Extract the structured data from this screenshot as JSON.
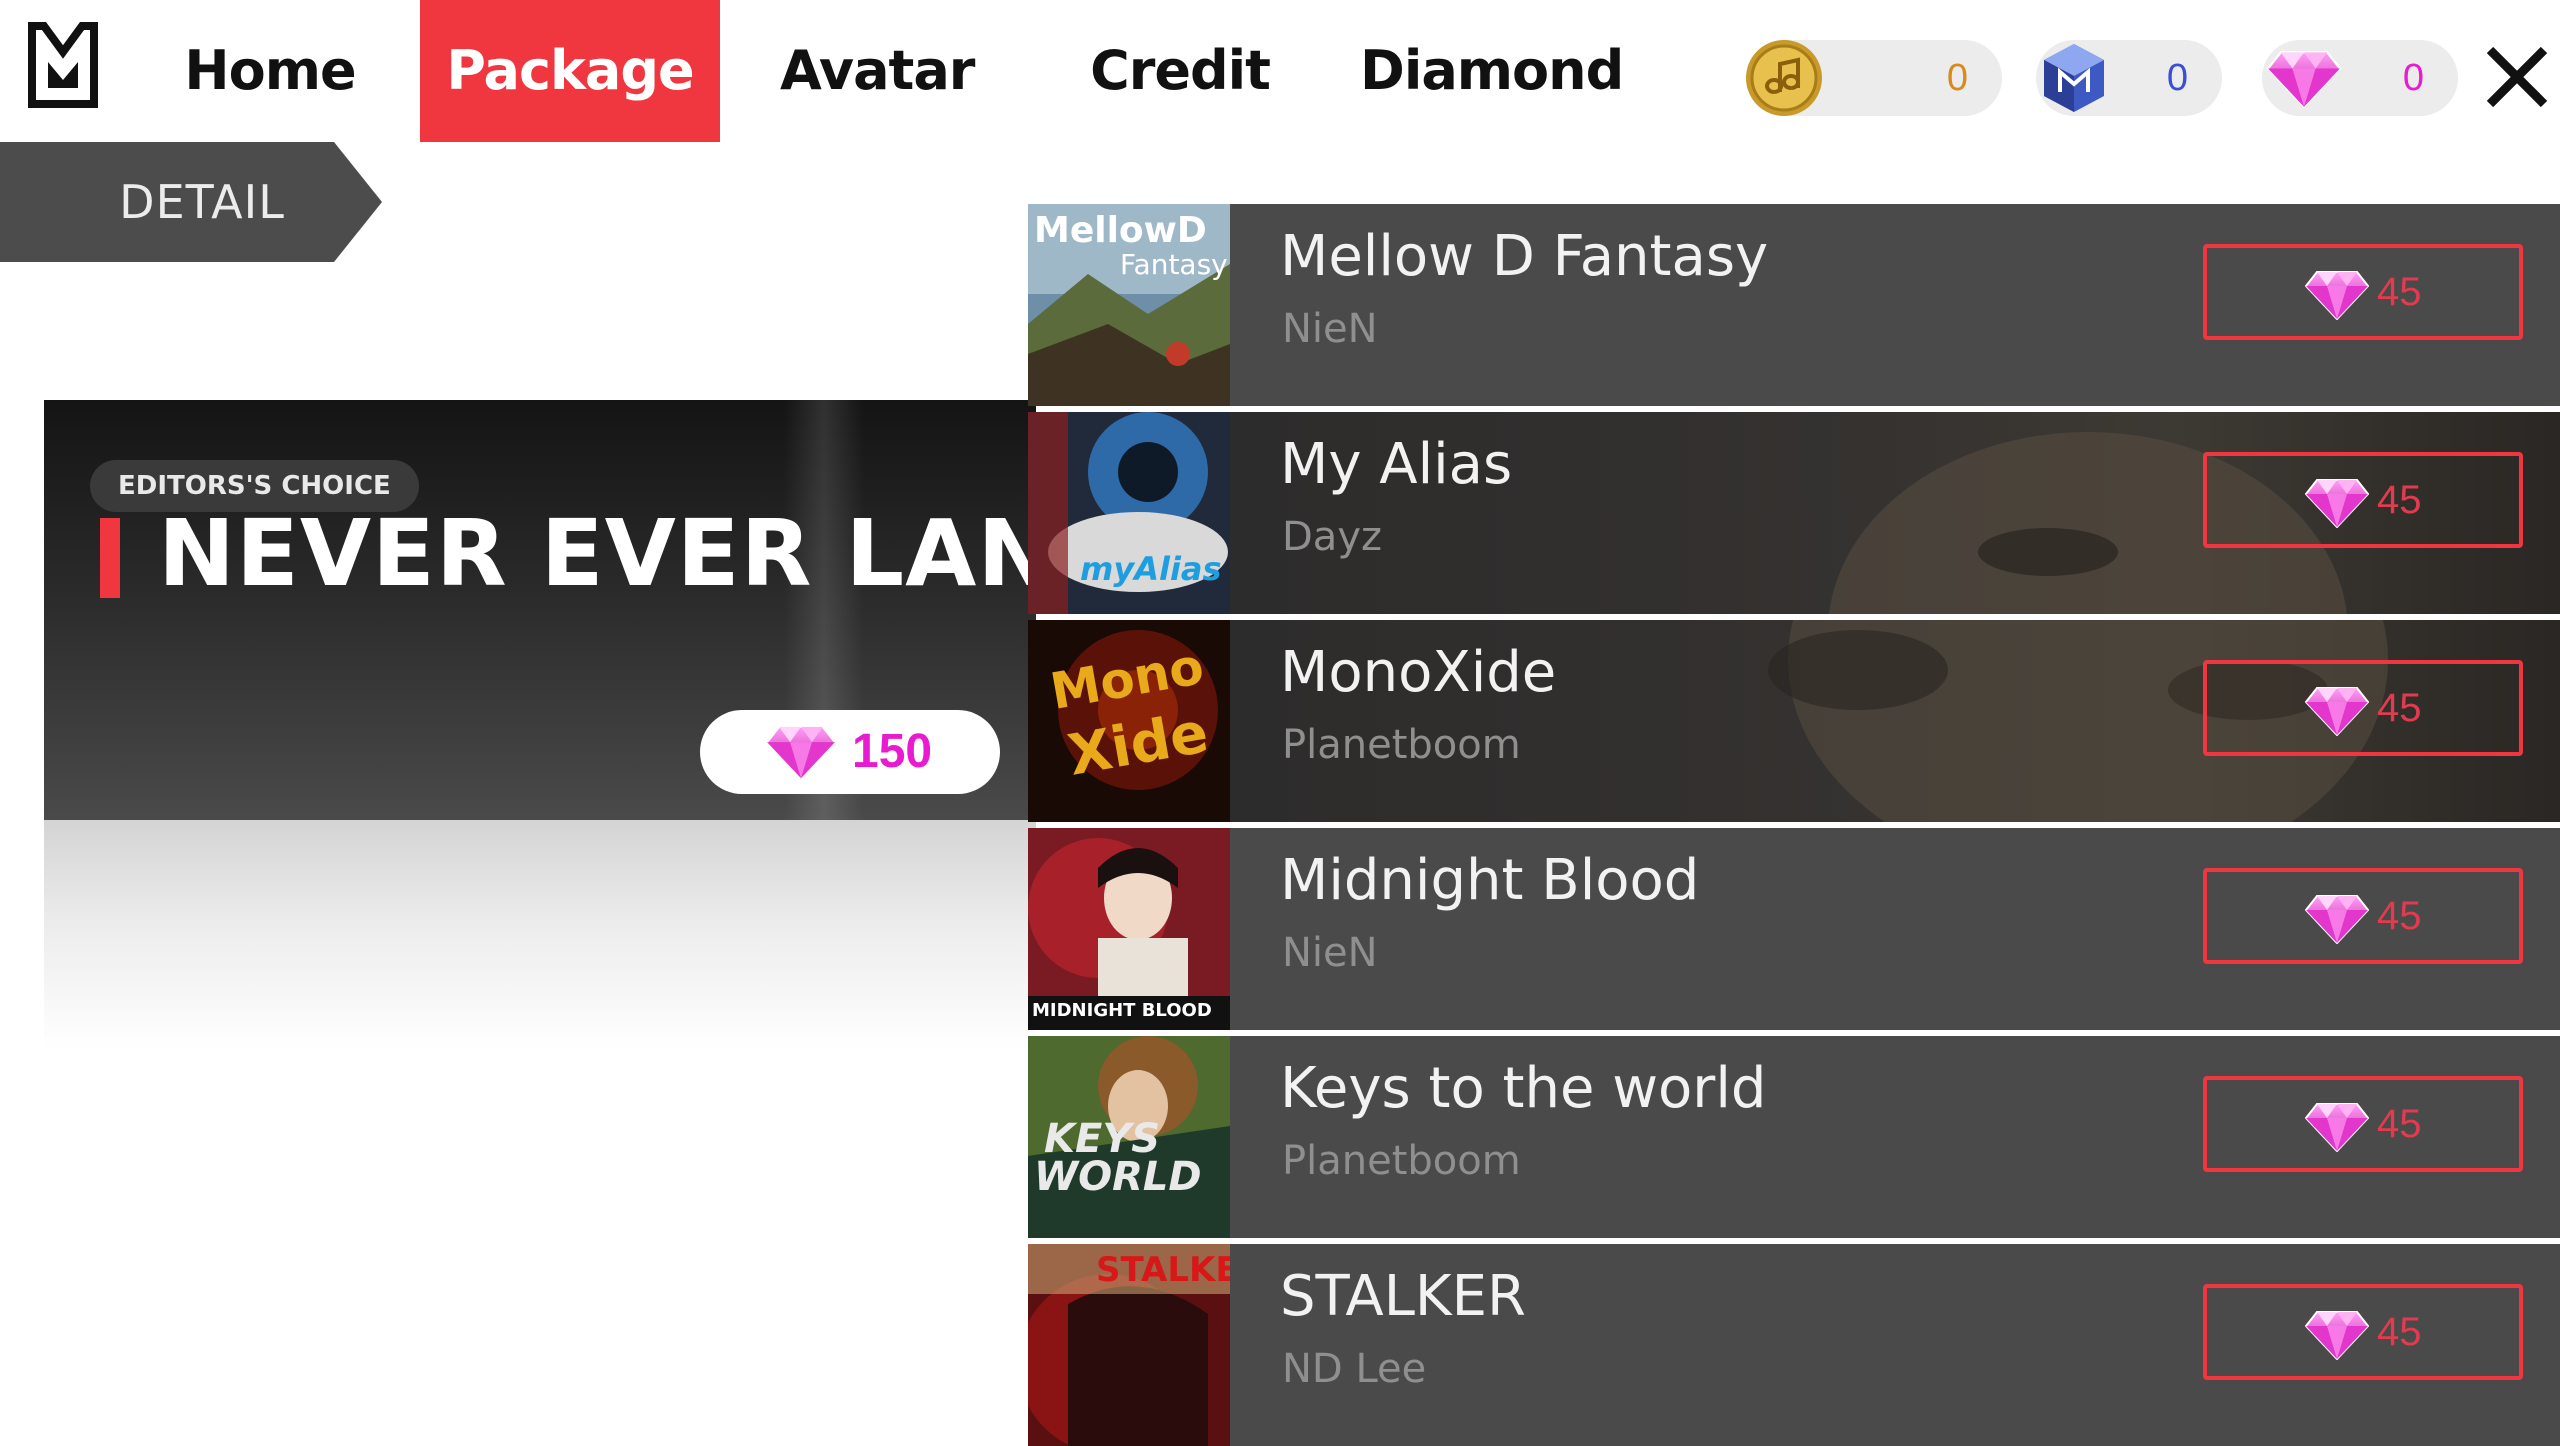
{
  "nav": {
    "tabs": [
      {
        "label": "Home",
        "active": false
      },
      {
        "label": "Package",
        "active": true
      },
      {
        "label": "Avatar",
        "active": false
      },
      {
        "label": "Credit",
        "active": false
      },
      {
        "label": "Diamond",
        "active": false
      }
    ]
  },
  "wallet": {
    "music_coin": {
      "value": "0",
      "icon": "music-coin-icon",
      "color": "#d98a1a"
    },
    "cube": {
      "value": "0",
      "icon": "cube-icon",
      "color": "#3a4fd6"
    },
    "diamond": {
      "value": "0",
      "icon": "diamond-icon",
      "color": "#e81bd0"
    }
  },
  "detail_tab": {
    "label": "DETAIL"
  },
  "featured": {
    "badge": "EDITORS'S CHOICE",
    "title": "NEVER EVER LAND",
    "price": "150"
  },
  "songs": [
    {
      "title": "Mellow D Fantasy",
      "artist": "NieN",
      "price": "45",
      "art_text": "MellowD",
      "art_text2": "Fantasy"
    },
    {
      "title": "My Alias",
      "artist": "Dayz",
      "price": "45",
      "art_text": "myAlias",
      "art_text2": ""
    },
    {
      "title": "MonoXide",
      "artist": "Planetboom",
      "price": "45",
      "art_text": "Mono",
      "art_text2": "Xide"
    },
    {
      "title": "Midnight Blood",
      "artist": "NieN",
      "price": "45",
      "art_text": "MIDNIGHT BLOOD",
      "art_text2": ""
    },
    {
      "title": "Keys to the world",
      "artist": "Planetboom",
      "price": "45",
      "art_text": "KEYS",
      "art_text2": "WORLD"
    },
    {
      "title": "STALKER",
      "artist": "ND Lee",
      "price": "45",
      "art_text": "STALKER",
      "art_text2": ""
    }
  ],
  "colors": {
    "accent": "#f0363f",
    "gem": "#e81bd0"
  }
}
